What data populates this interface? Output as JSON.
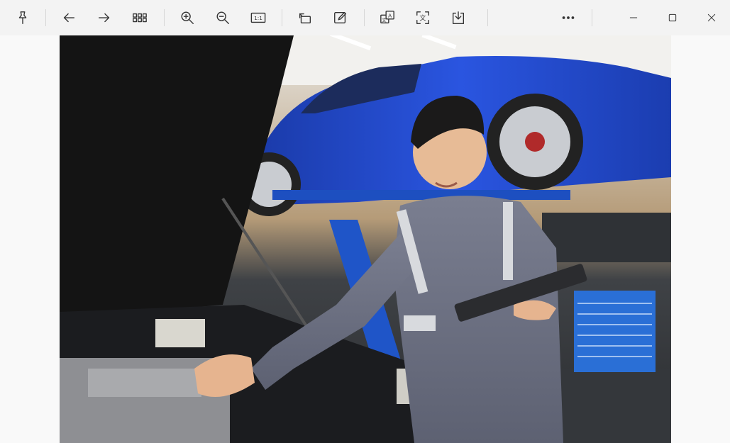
{
  "toolbar": {
    "pin": {
      "icon": "pin-icon"
    },
    "back": {
      "icon": "arrow-left-icon"
    },
    "forward": {
      "icon": "arrow-right-icon"
    },
    "gallery": {
      "icon": "grid-icon"
    },
    "zoom_in": {
      "icon": "zoom-in-icon"
    },
    "zoom_out": {
      "icon": "zoom-out-icon"
    },
    "actual_size": {
      "icon": "actual-size-icon",
      "label": "1:1"
    },
    "rotate": {
      "icon": "rotate-icon"
    },
    "edit": {
      "icon": "edit-icon"
    },
    "translate": {
      "icon": "translate-icon",
      "glyph_a": "A",
      "glyph_b": "文"
    },
    "extract_text": {
      "icon": "extract-text-icon",
      "glyph": "文"
    },
    "save": {
      "icon": "save-icon"
    },
    "more": {
      "icon": "more-icon"
    }
  },
  "window_controls": {
    "minimize": {
      "icon": "minimize-icon"
    },
    "maximize": {
      "icon": "maximize-icon"
    },
    "close": {
      "icon": "close-icon"
    }
  },
  "image": {
    "subject": "mechanic-with-tablet-in-garage",
    "colors": {
      "car": "#1f45c9",
      "uniform": "#6f7385",
      "background": "#3a3d40",
      "hood": "#141414",
      "cabinet": "#2a6fd6"
    }
  }
}
